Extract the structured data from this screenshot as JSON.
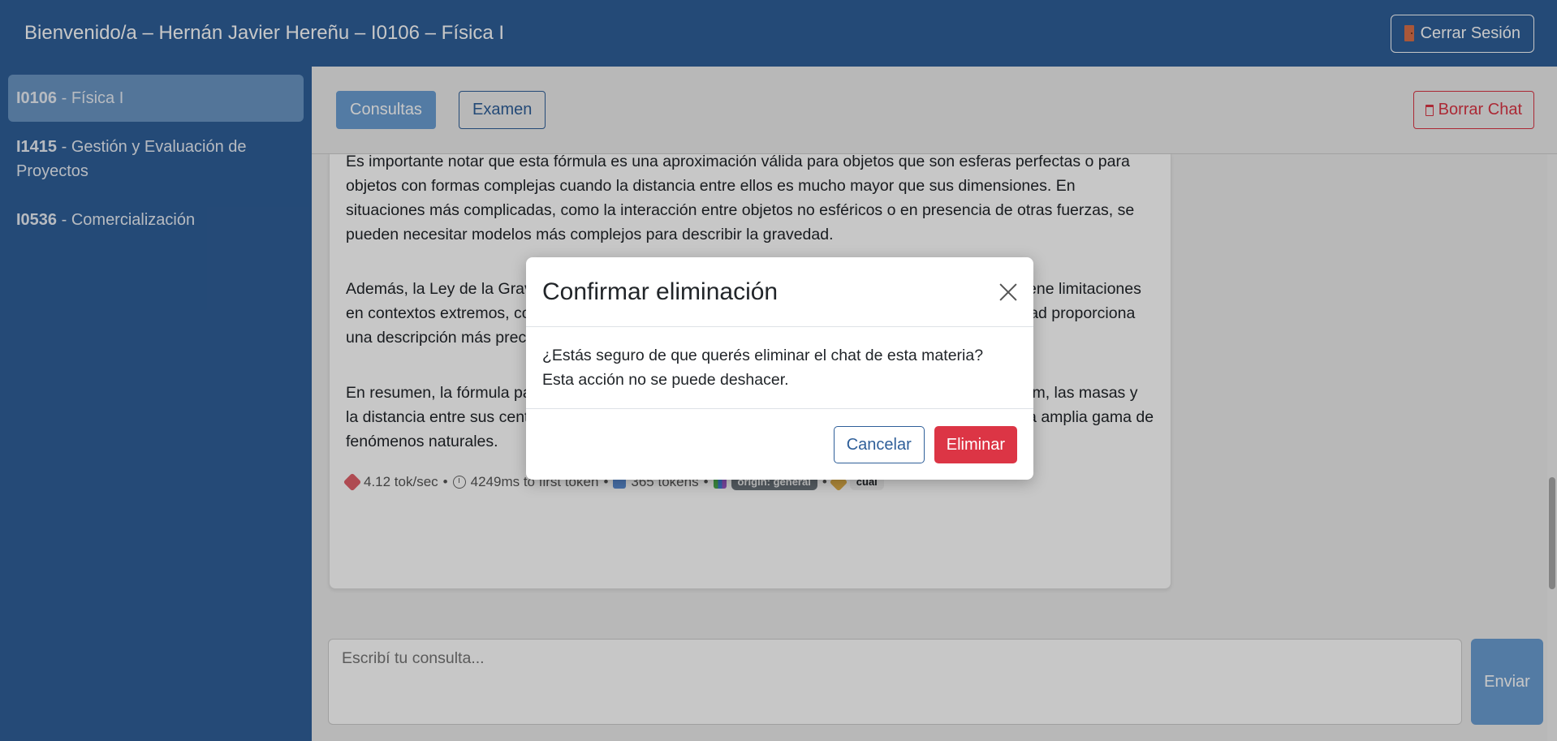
{
  "header": {
    "title": "Bienvenido/a – Hernán Javier Hereñu – I0106 – Física I",
    "logout_label": "Cerrar Sesión",
    "logout_icon": "door-icon"
  },
  "sidebar": {
    "items": [
      {
        "code": "I0106",
        "name": " - Física I"
      },
      {
        "code": "I1415",
        "name": " - Gestión y Evaluación de Proyectos"
      },
      {
        "code": "I0536",
        "name": " - Comercialización"
      }
    ]
  },
  "tabs": {
    "consultas": "Consultas",
    "examen": "Examen",
    "clear_chat": "Borrar Chat"
  },
  "message": {
    "p1": "Es importante notar que esta fórmula es una aproximación válida para objetos que son esferas perfectas o para objetos con formas complejas cuando la distancia entre ellos es mucho mayor que sus dimensiones. En situaciones más complicadas, como la interacción entre objetos no esféricos o en presencia de otras fuerzas, se pueden necesitar modelos más complejos para describir la gravedad.",
    "p2": "Además, la Ley de la Gravitación Universal de Newton, aunque precisa en muchas situaciones, tiene limitaciones en contextos extremos, como agujeros negros o en velocidades muy altas; la teoría de la relatividad proporciona una descripción más precisa de la gravedad.",
    "p3": "En resumen, la fórmula para la fuerza gravitacional relaciona la constante gravitacional universal, m, las masas y la distancia entre sus centros. Esta fórmula es fundamental en la física y tiene aplicaciones en una amplia gama de fenómenos naturales.",
    "meta": {
      "speed": "4.12 tok/sec",
      "first_token": "4249ms to first token",
      "tokens": "365 tokens",
      "origin_badge": "origin: general",
      "tag_badge": "cual",
      "sep": "•"
    }
  },
  "composer": {
    "placeholder": "Escribí tu consulta...",
    "send_label": "Enviar"
  },
  "modal": {
    "title": "Confirmar eliminación",
    "body_line1": "¿Estás seguro de que querés eliminar el chat de esta materia?",
    "body_line2": "Esta acción no se puede deshacer.",
    "cancel_label": "Cancelar",
    "delete_label": "Eliminar"
  },
  "colors": {
    "brand": "#2f5f99",
    "accent": "#6b9ed2",
    "danger": "#dc3545"
  }
}
